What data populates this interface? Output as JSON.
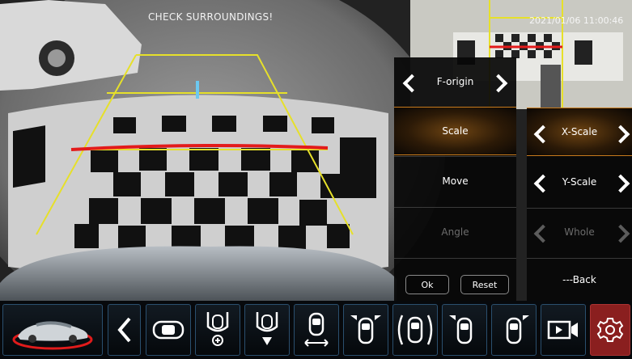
{
  "overlay": {
    "warning": "CHECK  SURROUNDINGS!",
    "timestamp": "2021/01/06  11:00:46"
  },
  "menu": {
    "items": [
      {
        "label": "F-origin",
        "state": "normal"
      },
      {
        "label": "Scale",
        "state": "selected"
      },
      {
        "label": "Move",
        "state": "normal"
      },
      {
        "label": "Angle",
        "state": "disabled"
      }
    ],
    "ok_label": "Ok",
    "reset_label": "Reset"
  },
  "submenu": {
    "items": [
      {
        "label": "X-Scale",
        "state": "selected"
      },
      {
        "label": "Y-Scale",
        "state": "normal"
      },
      {
        "label": "Whole",
        "state": "disabled"
      }
    ],
    "back_label": "---Back"
  },
  "toolbar": {
    "buttons": [
      {
        "icon": "car-model-icon"
      },
      {
        "icon": "back-arrow-icon"
      },
      {
        "icon": "top-view-car-icon"
      },
      {
        "icon": "zoom-in-view-icon"
      },
      {
        "icon": "down-view-icon"
      },
      {
        "icon": "side-view-icon"
      },
      {
        "icon": "front-corners-view-icon"
      },
      {
        "icon": "panorama-view-icon"
      },
      {
        "icon": "front-left-view-icon"
      },
      {
        "icon": "front-right-view-icon"
      },
      {
        "icon": "record-camera-icon"
      },
      {
        "icon": "settings-gear-icon"
      }
    ],
    "accent_color": "#2a4f6e",
    "active_color": "#8a1f1f"
  },
  "colors": {
    "guide_line": "#e6e02a",
    "stop_line": "#e31b1b",
    "center_mark": "#6cc8f0",
    "menu_highlight": "#c77a1c"
  }
}
